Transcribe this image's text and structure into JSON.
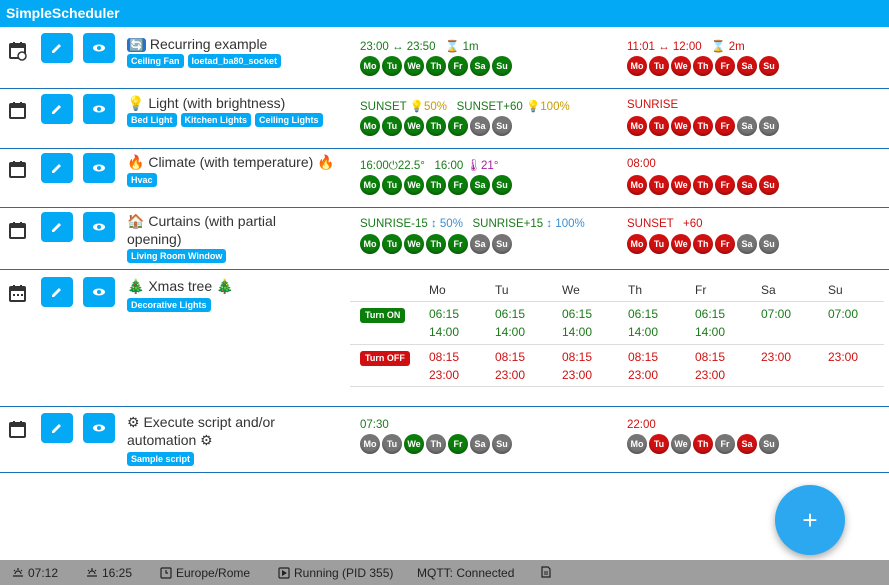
{
  "app": {
    "title": "SimpleScheduler"
  },
  "rows": [
    {
      "icon": "calendar-recurring-icon",
      "title_icon": "🔄",
      "title": "Recurring example",
      "tags": [
        "Ceiling Fan",
        "loetad_ba80_socket"
      ],
      "on": {
        "text1": "23:00",
        "text2": "↔",
        "text3": "23:50",
        "text4": "⌛ 1m",
        "days": [
          "Mo",
          "Tu",
          "We",
          "Th",
          "Fr",
          "Sa",
          "Su"
        ],
        "active": [
          1,
          1,
          1,
          1,
          1,
          1,
          1
        ]
      },
      "off": {
        "text1": "11:01",
        "text2": "↔",
        "text3": "12:00",
        "text4": "⌛ 2m",
        "days": [
          "Mo",
          "Tu",
          "We",
          "Th",
          "Fr",
          "Sa",
          "Su"
        ],
        "active": [
          1,
          1,
          1,
          1,
          1,
          1,
          1
        ]
      }
    },
    {
      "icon": "calendar-icon",
      "title_icon": "💡",
      "title": "Light (with brightness)",
      "tags": [
        "Bed Light",
        "Kitchen Lights",
        "Ceiling Lights"
      ],
      "on": {
        "text1": "SUNSET",
        "text2": "💡50%",
        "text3": "SUNSET+60",
        "text4": "💡100%",
        "days": [
          "Mo",
          "Tu",
          "We",
          "Th",
          "Fr",
          "Sa",
          "Su"
        ],
        "active": [
          1,
          1,
          1,
          1,
          1,
          0,
          0
        ]
      },
      "off": {
        "text1": "SUNRISE",
        "days": [
          "Mo",
          "Tu",
          "We",
          "Th",
          "Fr",
          "Sa",
          "Su"
        ],
        "active": [
          1,
          1,
          1,
          1,
          1,
          0,
          0
        ]
      }
    },
    {
      "icon": "calendar-icon",
      "title_icon": "🔥",
      "title": "Climate (with temperature)",
      "title_icon_end": "🔥",
      "tags": [
        "Hvac"
      ],
      "on": {
        "text1": "16:00",
        "text2": "⏻22.5°",
        "text3": "16:00",
        "text4": "🌡21°",
        "days": [
          "Mo",
          "Tu",
          "We",
          "Th",
          "Fr",
          "Sa",
          "Su"
        ],
        "active": [
          1,
          1,
          1,
          1,
          1,
          1,
          1
        ]
      },
      "off": {
        "text1": "08:00",
        "days": [
          "Mo",
          "Tu",
          "We",
          "Th",
          "Fr",
          "Sa",
          "Su"
        ],
        "active": [
          1,
          1,
          1,
          1,
          1,
          1,
          1
        ]
      }
    },
    {
      "icon": "calendar-icon",
      "title_icon": "🏠",
      "title": "Curtains (with partial opening)",
      "tags": [
        "Living Room Window"
      ],
      "on": {
        "text1": "SUNRISE-15",
        "text2": "↕ 50%",
        "text3": "SUNRISE+15",
        "text4": "↕ 100%",
        "days": [
          "Mo",
          "Tu",
          "We",
          "Th",
          "Fr",
          "Sa",
          "Su"
        ],
        "active": [
          1,
          1,
          1,
          1,
          1,
          0,
          0
        ]
      },
      "off": {
        "text1": "SUNSET",
        "text3": "+60",
        "days": [
          "Mo",
          "Tu",
          "We",
          "Th",
          "Fr",
          "Sa",
          "Su"
        ],
        "active": [
          1,
          1,
          1,
          1,
          1,
          0,
          0
        ]
      }
    },
    {
      "icon": "calendar-week-icon",
      "title_icon": "🎄",
      "title": "Xmas tree",
      "title_icon_end": "🎄",
      "tags": [
        "Decorative Lights"
      ],
      "weekly": {
        "headers": [
          "Mo",
          "Tu",
          "We",
          "Th",
          "Fr",
          "Sa",
          "Su"
        ],
        "on_label": "Turn ON",
        "off_label": "Turn OFF",
        "on": [
          [
            "06:15",
            "14:00"
          ],
          [
            "06:15",
            "14:00"
          ],
          [
            "06:15",
            "14:00"
          ],
          [
            "06:15",
            "14:00"
          ],
          [
            "06:15",
            "14:00"
          ],
          [
            "07:00",
            ""
          ],
          [
            "07:00",
            ""
          ]
        ],
        "off": [
          [
            "08:15",
            "23:00"
          ],
          [
            "08:15",
            "23:00"
          ],
          [
            "08:15",
            "23:00"
          ],
          [
            "08:15",
            "23:00"
          ],
          [
            "08:15",
            "23:00"
          ],
          [
            "23:00",
            ""
          ],
          [
            "23:00",
            ""
          ]
        ]
      }
    },
    {
      "icon": "calendar-icon",
      "title_icon": "⚙",
      "title": "Execute script and/or automation",
      "title_icon_end": "⚙",
      "tags": [
        "Sample script"
      ],
      "on": {
        "text1": "07:30",
        "days": [
          "Mo",
          "Tu",
          "We",
          "Th",
          "Fr",
          "Sa",
          "Su"
        ],
        "active": [
          0,
          0,
          1,
          0,
          1,
          0,
          0
        ]
      },
      "off": {
        "text1": "22:00",
        "days": [
          "Mo",
          "Tu",
          "We",
          "Th",
          "Fr",
          "Sa",
          "Su"
        ],
        "active": [
          0,
          1,
          0,
          1,
          0,
          1,
          0
        ]
      }
    }
  ],
  "fab": {
    "label": "+"
  },
  "status": {
    "sunrise": "07:12",
    "sunset": "16:25",
    "timezone": "Europe/Rome",
    "running": "Running (PID 355)",
    "mqtt": "MQTT: Connected"
  },
  "colors": {
    "accent": "#03a9f4",
    "on": "#0a7d0a",
    "off": "#d01010",
    "inactive": "#757575",
    "status_bar": "#9e9e9e"
  }
}
